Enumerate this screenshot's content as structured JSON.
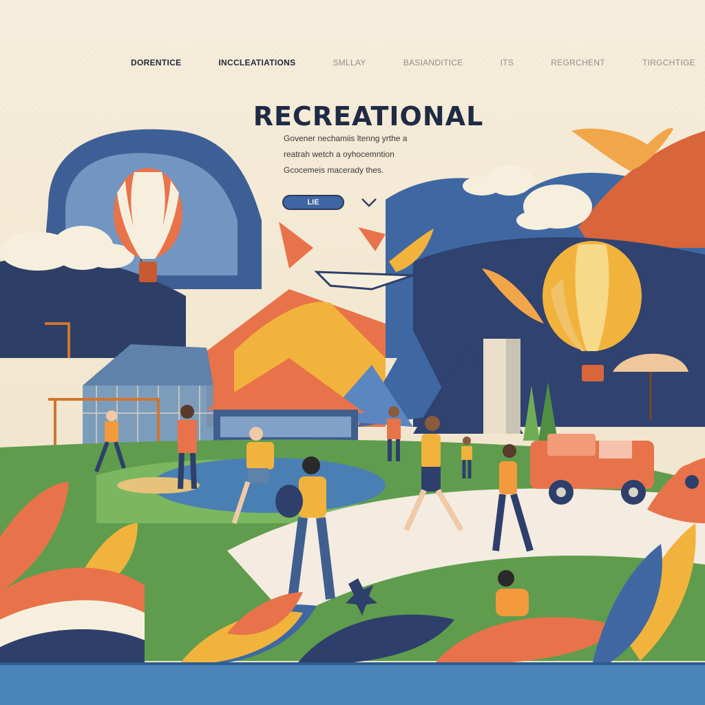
{
  "nav": {
    "items": [
      {
        "label": "DORENTICE",
        "state": "active"
      },
      {
        "label": "INCCLEATIATIONS",
        "state": "active"
      },
      {
        "label": "SMLLAY",
        "state": "dim"
      },
      {
        "label": "BASIANDITICE",
        "state": "dim"
      },
      {
        "label": "ITS",
        "state": "dim"
      },
      {
        "label": "REGRCHENT",
        "state": "dim"
      },
      {
        "label": "TIRGCHTIGE",
        "state": "dim"
      }
    ]
  },
  "hero": {
    "title": "RECREATIONAL",
    "description": [
      "Govener nechamiis ltenng yrthe a",
      "reatrah wetch a oyhocemntion",
      "Gcocemeis macerady thes."
    ],
    "cta_label": "LIE"
  },
  "colors": {
    "background": "#f4ead6",
    "title": "#1f2b44",
    "button": "#3f66a3",
    "orange": "#e8734a",
    "yellow": "#f2b33d",
    "navy": "#2e3f6b",
    "blue": "#4a84b8",
    "green": "#6dae55"
  },
  "icons": {
    "cta_mark": "chevron-down-icon"
  }
}
